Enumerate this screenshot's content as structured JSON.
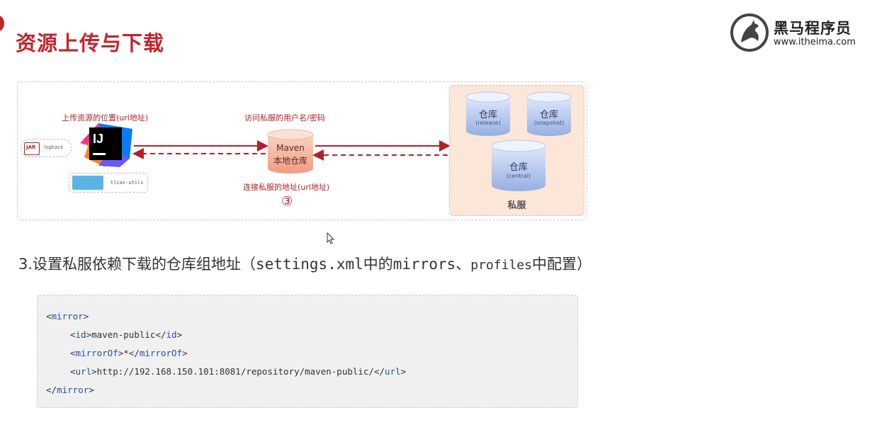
{
  "header": {
    "title": "资源上传与下载",
    "logo_cn": "黑马程序员",
    "logo_url": "www.itheima.com"
  },
  "diagram": {
    "upload_location_label": "上传资源的位置(url地址)",
    "credentials_label": "访问私服的用户名/密码",
    "connect_address_label": "连接私服的地址(url地址)",
    "step_marker": "③",
    "local_repo": {
      "line1": "Maven",
      "line2": "本地仓库"
    },
    "jar_badge": "JAR",
    "jar_name": "logback",
    "module_name": "tlias-utils",
    "ide_letters": "IJ",
    "private_server_label": "私服",
    "repositories": [
      {
        "name": "仓库",
        "type": "(release)"
      },
      {
        "name": "仓库",
        "type": "(snapshot)"
      },
      {
        "name": "仓库",
        "type": "(central)"
      }
    ]
  },
  "section": {
    "prefix": "3.设置私服依赖下载的仓库组地址（",
    "mono1": "settings.xml",
    "mid": "中的",
    "mono2": "mirrors",
    "sep": "、",
    "small": "profiles",
    "suffix": "中配置）"
  },
  "code": {
    "mirror_tag": "mirror",
    "id_tag": "id",
    "id_value": "maven-public",
    "mirrorOf_tag": "mirrorOf",
    "mirrorOf_value": "*",
    "url_tag": "url",
    "url_value": "http://192.168.150.101:8081/repository/maven-public/"
  },
  "colors": {
    "accent": "#c0262d",
    "arrow": "#b2202a",
    "panel_bg": "#fbe6d8",
    "cylinder_blue": "#9fb6e6",
    "cylinder_salmon": "#f3a58d",
    "code_tag": "#2450a8"
  }
}
